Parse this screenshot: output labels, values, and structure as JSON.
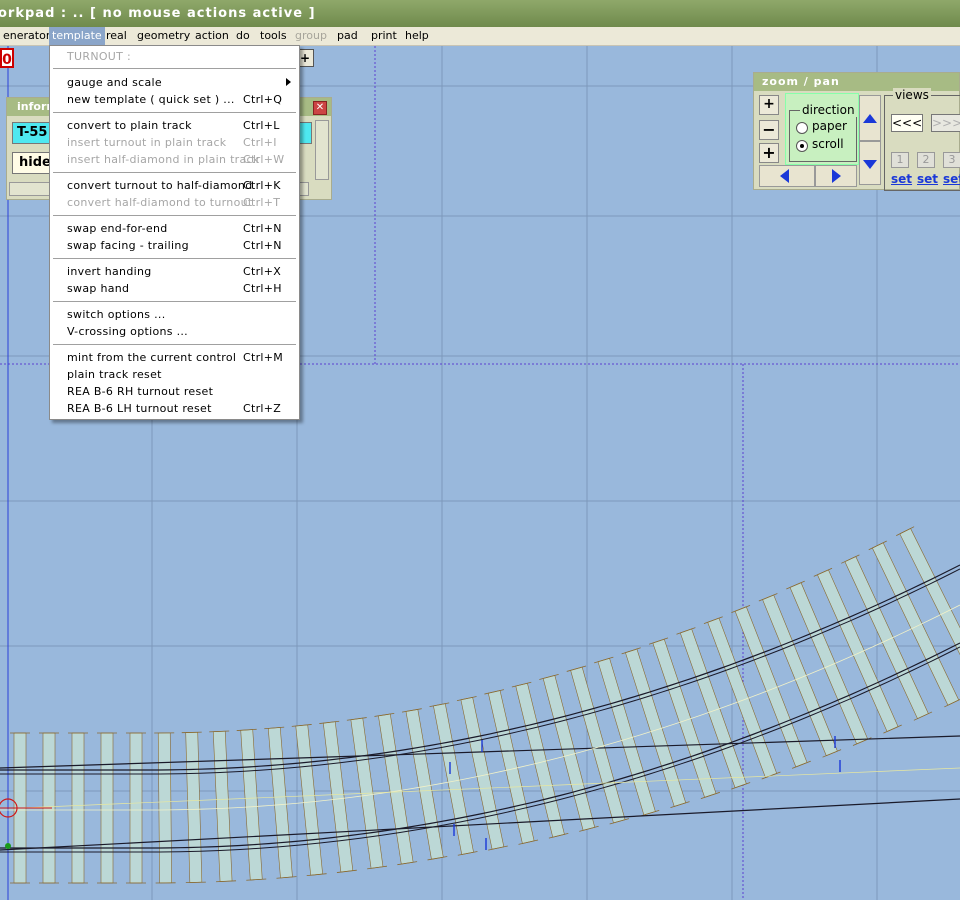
{
  "window": {
    "title": "orkpad :   ..    [  no  mouse  actions  active  ]"
  },
  "menubar": {
    "items": [
      {
        "label": "enerator",
        "state": "normal"
      },
      {
        "label": "template",
        "state": "active"
      },
      {
        "label": "real",
        "state": "normal"
      },
      {
        "label": "geometry",
        "state": "normal"
      },
      {
        "label": "action",
        "state": "normal"
      },
      {
        "label": "do",
        "state": "normal"
      },
      {
        "label": "tools",
        "state": "normal"
      },
      {
        "label": "group",
        "state": "disabled"
      },
      {
        "label": "pad",
        "state": "normal"
      },
      {
        "label": "print",
        "state": "normal"
      },
      {
        "label": "help",
        "state": "normal"
      }
    ]
  },
  "toolbar": {
    "red_box_text": "0"
  },
  "info_panel": {
    "title": "inforn",
    "template_name": "T-55",
    "hide_label": "hide",
    "close_glyph": "✕"
  },
  "template_menu": {
    "header": "TURNOUT :",
    "items": [
      {
        "label": "gauge  and  scale",
        "shortcut": "",
        "disabled": false,
        "submenu": true
      },
      {
        "label": "new  template  ( quick  set )  ...",
        "shortcut": "Ctrl+Q",
        "disabled": false
      },
      {
        "label": "convert  to  plain  track",
        "shortcut": "Ctrl+L",
        "disabled": false
      },
      {
        "label": "insert  turnout  in  plain  track",
        "shortcut": "Ctrl+I",
        "disabled": true
      },
      {
        "label": "insert  half-diamond  in  plain  track",
        "shortcut": "Ctrl+W",
        "disabled": true
      },
      {
        "label": "convert  turnout  to  half-diamond",
        "shortcut": "Ctrl+K",
        "disabled": false
      },
      {
        "label": "convert  half-diamond  to  turnout",
        "shortcut": "Ctrl+T",
        "disabled": true
      },
      {
        "label": "swap  end-for-end",
        "shortcut": "Ctrl+N",
        "disabled": false
      },
      {
        "label": "swap  facing - trailing",
        "shortcut": "Ctrl+N",
        "disabled": false
      },
      {
        "label": "invert  handing",
        "shortcut": "Ctrl+X",
        "disabled": false
      },
      {
        "label": "swap  hand",
        "shortcut": "Ctrl+H",
        "disabled": false
      },
      {
        "label": "switch  options  ...",
        "shortcut": "",
        "disabled": false
      },
      {
        "label": "V-crossing  options  ...",
        "shortcut": "",
        "disabled": false
      },
      {
        "label": "mint  from  the  current  control",
        "shortcut": "Ctrl+M",
        "disabled": false
      },
      {
        "label": "plain  track  reset",
        "shortcut": "",
        "disabled": false
      },
      {
        "label": "REA  B-6  RH  turnout  reset",
        "shortcut": "",
        "disabled": false
      },
      {
        "label": "REA  B-6  LH  turnout  reset",
        "shortcut": "Ctrl+Z",
        "disabled": false
      }
    ]
  },
  "zoom_panel": {
    "title": "zoom  /  pan",
    "direction_label": "direction",
    "option_paper": "paper",
    "option_scroll": "scroll",
    "selected_direction": "scroll",
    "views_label": "views",
    "prev_views": "<<<",
    "next_views": ">>>",
    "view_numbers": [
      "1",
      "2",
      "3"
    ],
    "set_label": "set",
    "minus": "−",
    "plus": "+",
    "fit": "+",
    "back_small": "«",
    "fwd_small": "»"
  },
  "colors": {
    "canvas_bg": "#99b8dc",
    "grid_line": "#7d98bb",
    "page_boundary": "#5a3fd0",
    "sleeper_fill": "#bcd8d6",
    "sleeper_edge": "#8a6a30",
    "rail": "#1a1a2a"
  }
}
